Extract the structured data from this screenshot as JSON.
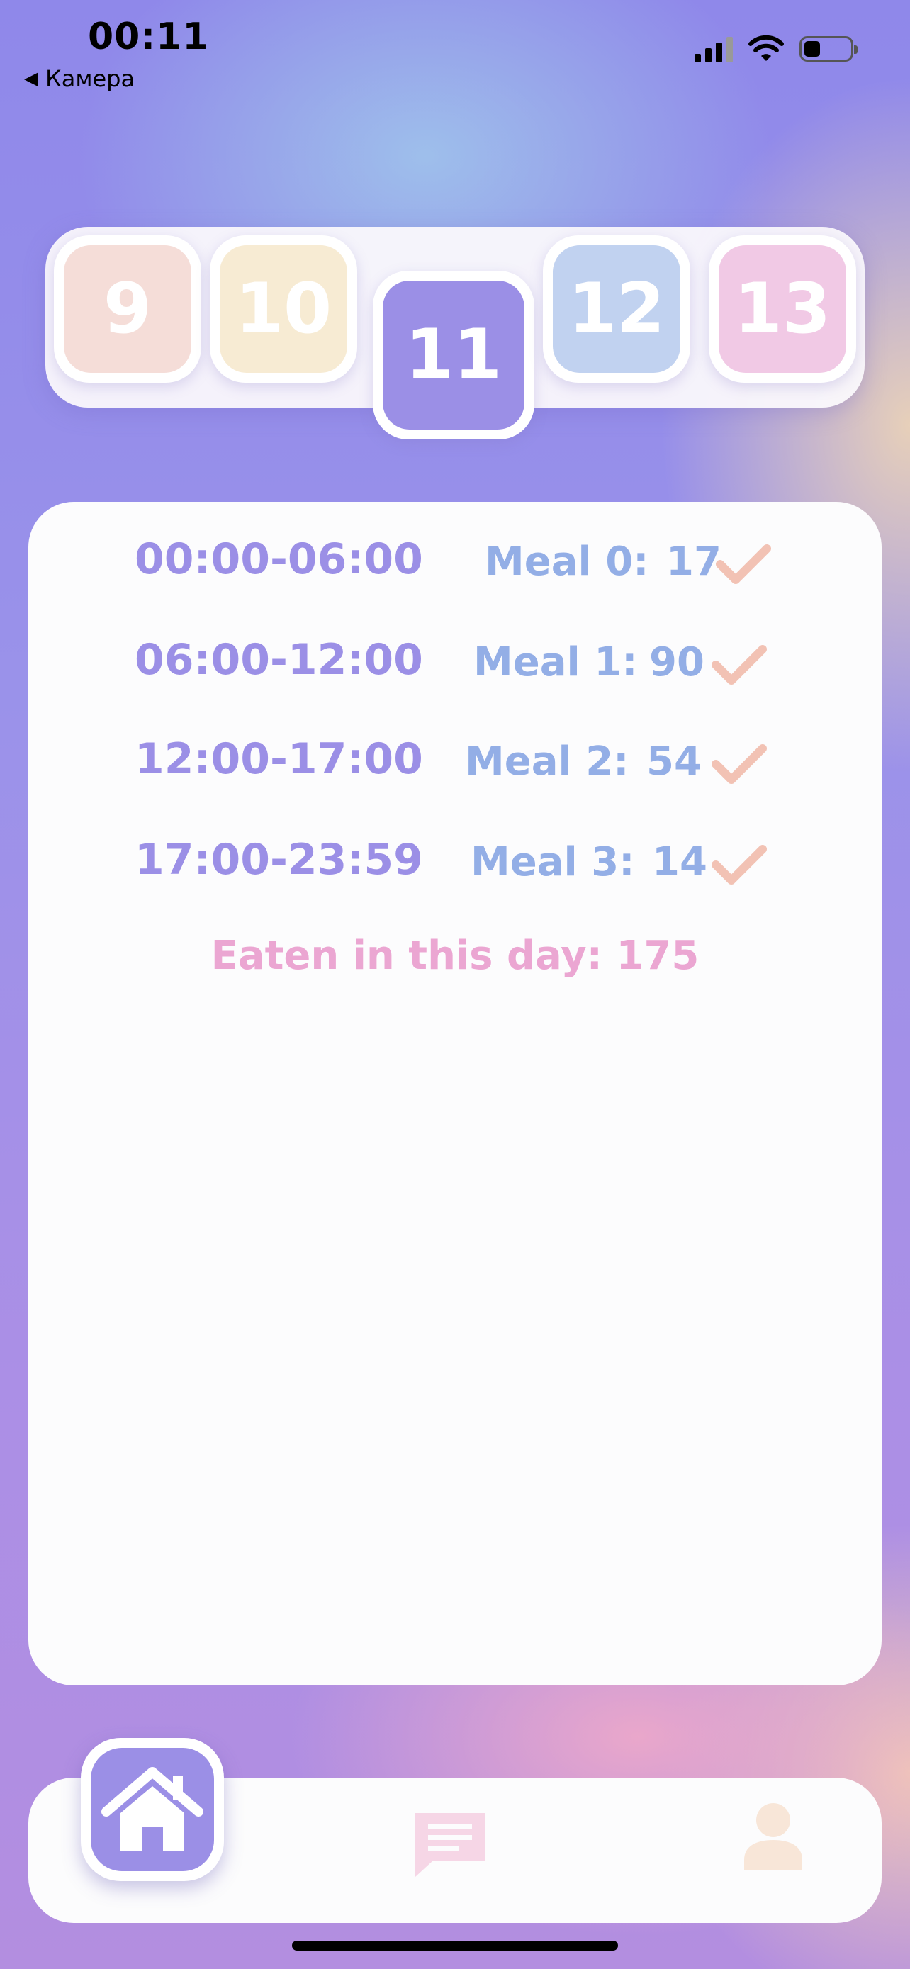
{
  "status_bar": {
    "time": "00:11",
    "back_label": "Камера",
    "back_icon": "back-triangle-icon",
    "icons": [
      "cellular-signal-icon",
      "wifi-icon",
      "battery-icon"
    ],
    "battery_level": 0.32
  },
  "date_strip": {
    "days": [
      {
        "label": "9",
        "color": "#f5ddd8",
        "selected": false
      },
      {
        "label": "10",
        "color": "#f7ebd3",
        "selected": false
      },
      {
        "label": "11",
        "color": "#9b8fe6",
        "selected": true
      },
      {
        "label": "12",
        "color": "#c1d2f0",
        "selected": false
      },
      {
        "label": "13",
        "color": "#f1c9e5",
        "selected": false
      }
    ]
  },
  "meals": [
    {
      "time": "00:00-06:00",
      "label": "Meal 0:",
      "value": "17",
      "checked": true
    },
    {
      "time": "06:00-12:00",
      "label": "Meal 1:",
      "value": "90",
      "checked": true
    },
    {
      "time": "12:00-17:00",
      "label": "Meal 2:",
      "value": "54",
      "checked": true
    },
    {
      "time": "17:00-23:59",
      "label": "Meal 3:",
      "value": "14",
      "checked": true
    }
  ],
  "total_text": "Eaten in this day: 175",
  "tab_bar": {
    "tabs": [
      {
        "name": "home",
        "icon": "home-icon",
        "active": true
      },
      {
        "name": "messages",
        "icon": "chat-icon",
        "active": false
      },
      {
        "name": "profile",
        "icon": "user-icon",
        "active": false
      }
    ]
  },
  "colors": {
    "accent": "#9b8fe6",
    "meal_label": "#93aee6",
    "total": "#eba6d2",
    "check": "#f2c2b4",
    "inactive_icon": "#f6d6e6"
  }
}
